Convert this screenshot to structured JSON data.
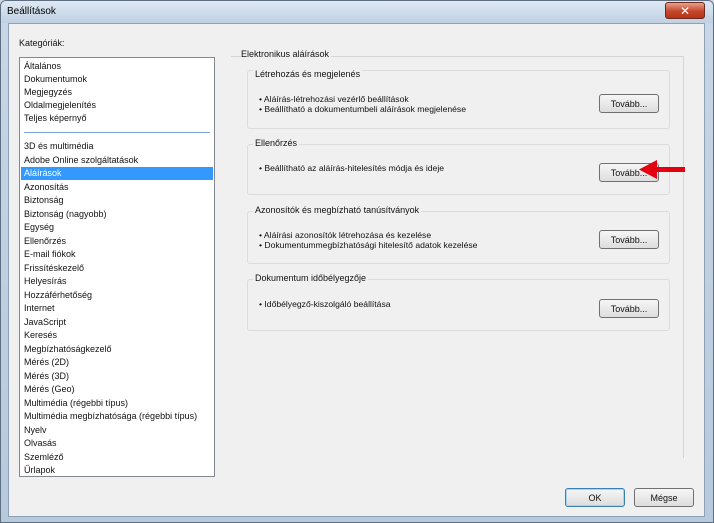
{
  "window": {
    "title": "Beállítások",
    "close_glyph": "✕"
  },
  "categories": {
    "label": "Kategóriák:",
    "group1": [
      "Általános",
      "Dokumentumok",
      "Megjegyzés",
      "Oldalmegjelenítés",
      "Teljes képernyő"
    ],
    "group2": [
      "3D és multimédia",
      "Adobe Online szolgáltatások",
      "Aláírások",
      "Azonosítás",
      "Biztonság",
      "Biztonság (nagyobb)",
      "Egység",
      "Ellenőrzés",
      "E-mail fiókok",
      "Frissítéskezelő",
      "Helyesírás",
      "Hozzáférhetőség",
      "Internet",
      "JavaScript",
      "Keresés",
      "Megbízhatóságkezelő",
      "Mérés (2D)",
      "Mérés (3D)",
      "Mérés (Geo)",
      "Multimédia (régebbi típus)",
      "Multimédia megbízhatósága (régebbi típus)",
      "Nyelv",
      "Olvasás",
      "Szemléző",
      "Űrlapok"
    ],
    "selected": "Aláírások"
  },
  "panel": {
    "title": "Elektronikus aláírások",
    "groups": [
      {
        "title": "Létrehozás és megjelenés",
        "bullets": [
          "• Aláírás-létrehozási vezérlő beállítások",
          "• Beállítható a dokumentumbeli aláírások megjelenése"
        ],
        "button": "Tovább..."
      },
      {
        "title": "Ellenőrzés",
        "bullets": [
          "• Beállítható az aláírás-hitelesítés módja és ideje"
        ],
        "button": "Tovább..."
      },
      {
        "title": "Azonosítók és megbízható tanúsítványok",
        "bullets": [
          "• Aláírási azonosítók létrehozása és kezelése",
          "• Dokumentummegbízhatósági hitelesítő adatok kezelése"
        ],
        "button": "Tovább..."
      },
      {
        "title": "Dokumentum időbélyegzője",
        "bullets": [
          "• Időbélyegző-kiszolgáló beállítása"
        ],
        "button": "Tovább..."
      }
    ]
  },
  "footer": {
    "ok": "OK",
    "cancel": "Mégse"
  },
  "colors": {
    "selection": "#3399ff",
    "annotation_arrow": "#e3000f"
  },
  "icons": {
    "annotation": "red-arrow-icon"
  }
}
